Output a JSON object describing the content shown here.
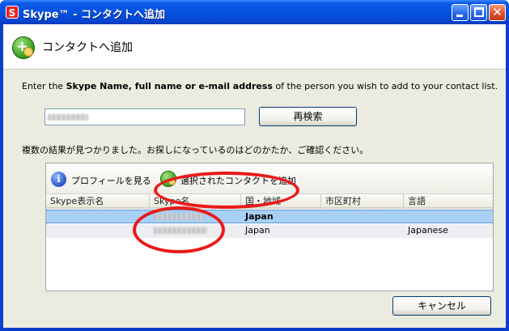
{
  "window": {
    "title": "Skype™ - コンタクトへ追加",
    "app_icon_letter": "S",
    "controls": {
      "minimize": "minimize",
      "maximize": "maximize",
      "close": "✕"
    }
  },
  "header": {
    "title": "コンタクトへ追加"
  },
  "instruction": {
    "prefix": "Enter the ",
    "bold": "Skype Name, full name or e-mail address",
    "suffix": " of the person you wish to add to your contact list."
  },
  "search": {
    "value": "",
    "research_button": "再検索"
  },
  "result_message": "複数の結果が見つかりました。お探しになっているのはどのかたか、ご確認ください。",
  "toolbar": {
    "view_profile": "プロフィールを見る",
    "add_selected": "選択されたコンタクトを追加"
  },
  "table": {
    "columns": [
      "Skype表示名",
      "Skype名",
      "国・地域",
      "市区町村",
      "言語"
    ],
    "rows": [
      {
        "display_name": "",
        "skype_name": "",
        "country": "Japan",
        "city": "",
        "language": ""
      },
      {
        "display_name": "",
        "skype_name": "",
        "country": "Japan",
        "city": "",
        "language": "Japanese"
      }
    ]
  },
  "footer": {
    "cancel_button": "キャンセル"
  },
  "colors": {
    "titlebar": "#0553e0",
    "annotation_circle": "#ea1a1a",
    "selected_row": "#a8d0f4",
    "dialog_bg": "#ecebe0"
  }
}
